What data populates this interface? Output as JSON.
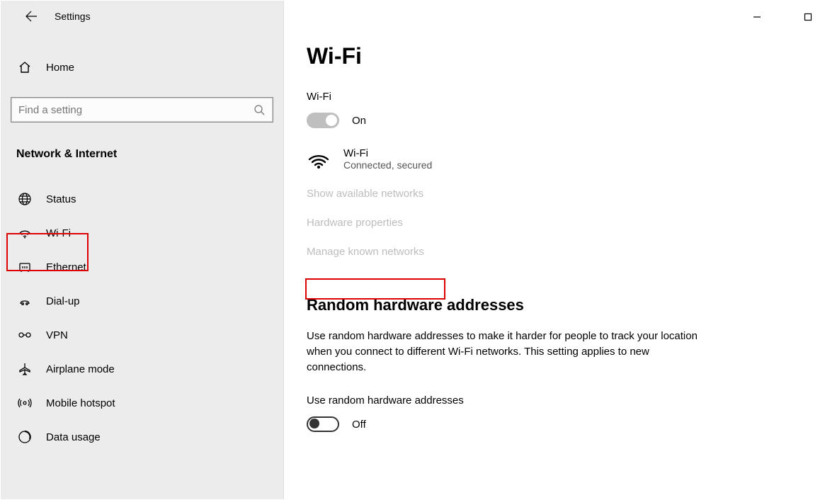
{
  "titlebar": {
    "title": "Settings"
  },
  "home": {
    "label": "Home"
  },
  "search": {
    "placeholder": "Find a setting"
  },
  "category": {
    "heading": "Network & Internet"
  },
  "nav": {
    "items": [
      {
        "label": "Status"
      },
      {
        "label": "Wi-Fi"
      },
      {
        "label": "Ethernet"
      },
      {
        "label": "Dial-up"
      },
      {
        "label": "VPN"
      },
      {
        "label": "Airplane mode"
      },
      {
        "label": "Mobile hotspot"
      },
      {
        "label": "Data usage"
      }
    ]
  },
  "page": {
    "title": "Wi-Fi",
    "wifi_section_label": "Wi-Fi",
    "wifi_toggle_state": "On",
    "connection": {
      "name": "Wi-Fi",
      "status": "Connected, secured"
    },
    "links": {
      "show_available": "Show available networks",
      "hardware_props": "Hardware properties",
      "manage_known": "Manage known networks"
    },
    "random_addr": {
      "heading": "Random hardware addresses",
      "desc": "Use random hardware addresses to make it harder for people to track your location when you connect to different Wi-Fi networks. This setting applies to new connections.",
      "toggle_label": "Use random hardware addresses",
      "toggle_state": "Off"
    }
  },
  "window_controls": {
    "minimize": "—",
    "maximize": "▢"
  }
}
